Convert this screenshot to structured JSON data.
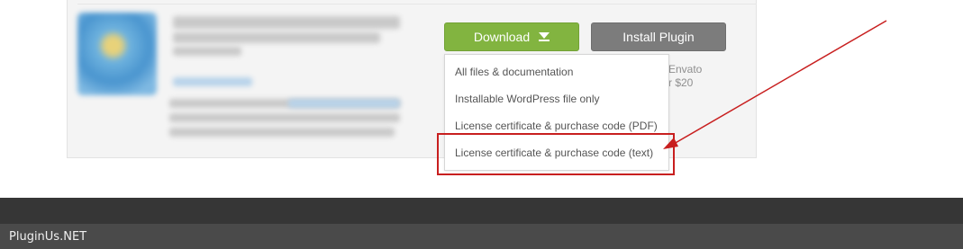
{
  "item": {
    "download_label": "Download",
    "install_label": "Install Plugin",
    "side_info_lines": [
      "Envato",
      "r $20"
    ]
  },
  "download_menu": {
    "options": [
      "All files & documentation",
      "Installable WordPress file only",
      "License certificate & purchase code (PDF)",
      "License certificate & purchase code (text)"
    ],
    "highlighted_option": "License certificate & purchase code (text)"
  },
  "annotation": {
    "color": "#c81f1f"
  },
  "footer": {
    "brand": "PluginUs.NET"
  },
  "colors": {
    "download_button": "#82b440",
    "install_button": "#7c7c7c",
    "footer_dark": "#363636",
    "footer_bar": "#4a4a4a"
  }
}
